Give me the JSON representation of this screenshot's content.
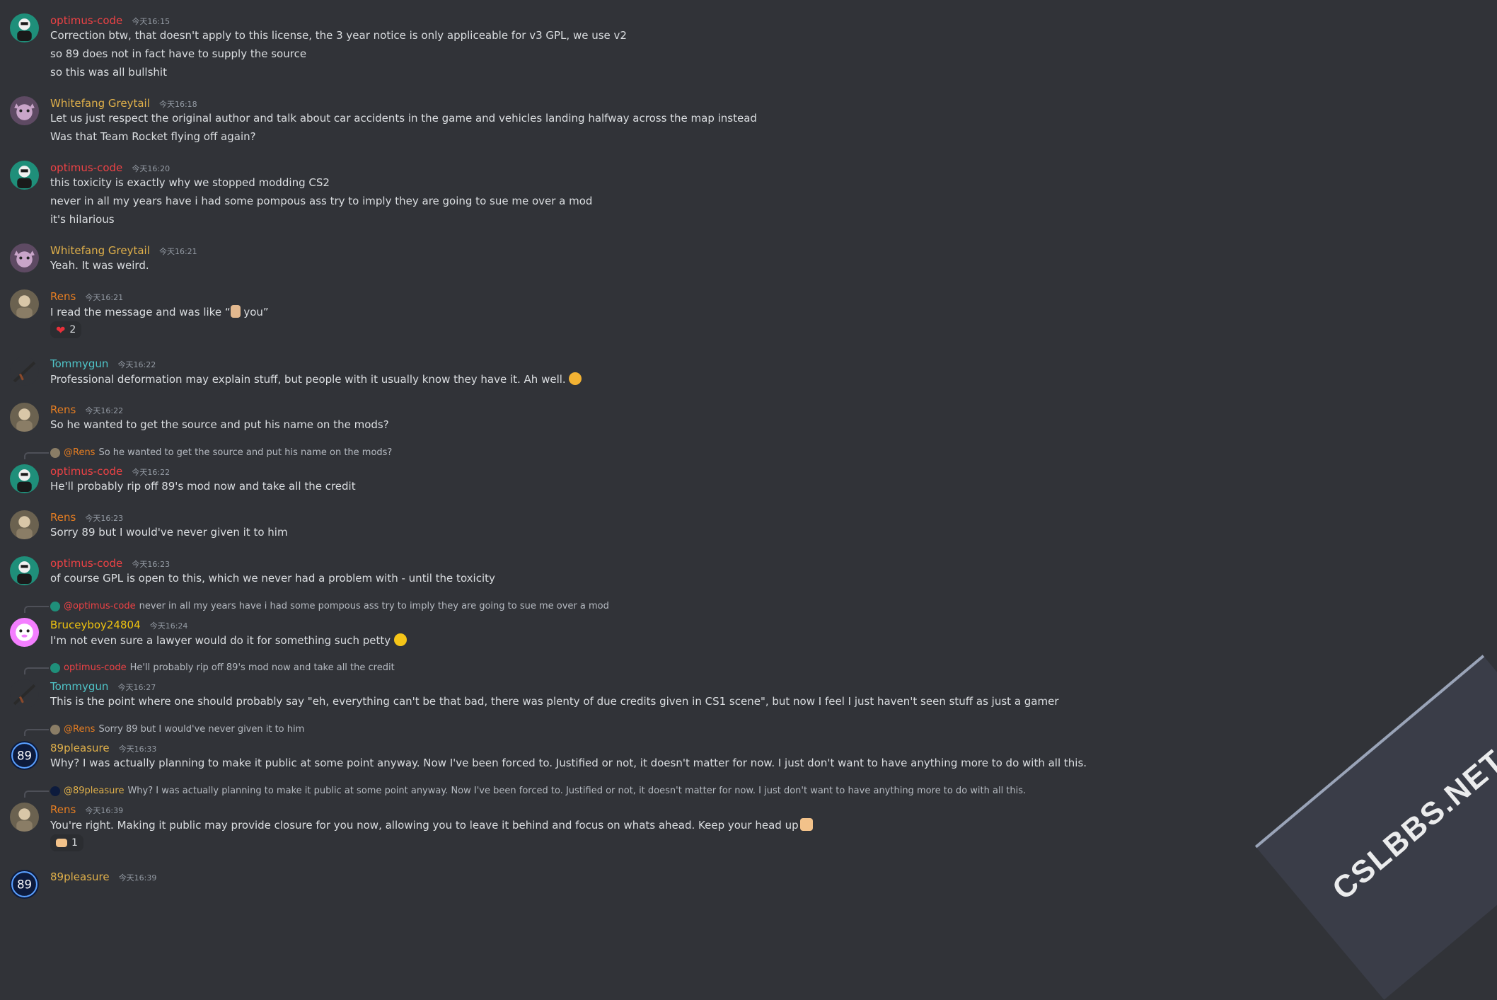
{
  "colors": {
    "background": "#313338",
    "optimus": "#ed4245",
    "whitefang": "#e0b04a",
    "rens": "#e67e22",
    "tommygun": "#4fc3c7",
    "bruceyboy": "#f1c40f",
    "pleasure": "#e0b04a"
  },
  "messages": [
    {
      "author": "optimus-code",
      "ts": "今天16:15",
      "lines": [
        "Correction btw, that doesn't apply to this license, the 3 year notice is only appliceable for v3 GPL, we use v2",
        "so 89 does not in fact have to supply the source",
        "so this was all bullshit"
      ]
    },
    {
      "author": "Whitefang Greytail",
      "ts": "今天16:18",
      "lines": [
        "Let us just respect the original author and talk about car accidents in the game and vehicles landing halfway across the map instead",
        "Was that Team Rocket flying off again?"
      ]
    },
    {
      "author": "optimus-code",
      "ts": "今天16:20",
      "lines": [
        "this toxicity is exactly why we stopped modding CS2",
        "never in all my years have i had some pompous ass try to imply they are going to sue me over a mod",
        "it's hilarious"
      ]
    },
    {
      "author": "Whitefang Greytail",
      "ts": "今天16:21",
      "lines": [
        "Yeah. It was weird."
      ]
    },
    {
      "author": "Rens",
      "ts": "今天16:21",
      "line_before": "I read the message and was like “",
      "line_after": " you”",
      "reaction_count": "2"
    },
    {
      "author": "Tommygun",
      "ts": "今天16:22",
      "lines": [
        "Professional deformation may explain stuff, but people with it usually know they have it. Ah well."
      ]
    },
    {
      "author": "Rens",
      "ts": "今天16:22",
      "lines": [
        "So he wanted to get the source and put his name on the mods?"
      ]
    },
    {
      "reply_author": "@Rens",
      "reply_text": "So he wanted to get the source and put his name on the mods?",
      "author": "optimus-code",
      "ts": "今天16:22",
      "lines": [
        "He'll probably rip off 89's mod now and take all the credit"
      ]
    },
    {
      "author": "Rens",
      "ts": "今天16:23",
      "lines": [
        "Sorry 89 but I would've never given it to him"
      ]
    },
    {
      "author": "optimus-code",
      "ts": "今天16:23",
      "lines": [
        "of course GPL is open to this, which we never had a problem with - until the toxicity"
      ]
    },
    {
      "reply_author": "@optimus-code",
      "reply_text": "never in all my years have i had some pompous ass try to imply they are going to sue me over a mod",
      "author": "Bruceyboy24804",
      "ts": "今天16:24",
      "lines": [
        "I'm not even sure a lawyer would do it for something such petty"
      ]
    },
    {
      "reply_author": "optimus-code",
      "reply_text": "He'll probably rip off 89's mod now and take all the credit",
      "author": "Tommygun",
      "ts": "今天16:27",
      "lines": [
        "This is the point where one should probably say \"eh, everything can't be that bad,  there was plenty of due credits given in CS1 scene\", but now I feel I just haven't seen stuff as just a gamer"
      ]
    },
    {
      "reply_author": "@Rens",
      "reply_text": "Sorry 89 but I would've never given it to him",
      "author": "89pleasure",
      "ts": "今天16:33",
      "lines": [
        "Why? I was actually planning to make it public at some point anyway. Now I've been forced to. Justified or not, it doesn't matter for now. I just don't want to have anything more to do with all this."
      ]
    },
    {
      "reply_author": "@89pleasure",
      "reply_text": "Why? I was actually planning to make it public at some point anyway. Now I've been forced to. Justified or not, it doesn't matter for now. I just don't want to have anything more to do with all this.",
      "author": "Rens",
      "ts": "今天16:39",
      "lines": [
        "You're right. Making it public may provide closure for you now, allowing you to leave it behind and focus on whats ahead. Keep your head up"
      ],
      "reaction_count": "1"
    },
    {
      "author": "89pleasure",
      "ts": "今天16:39"
    }
  ],
  "watermark": "CSLBBS.NET"
}
